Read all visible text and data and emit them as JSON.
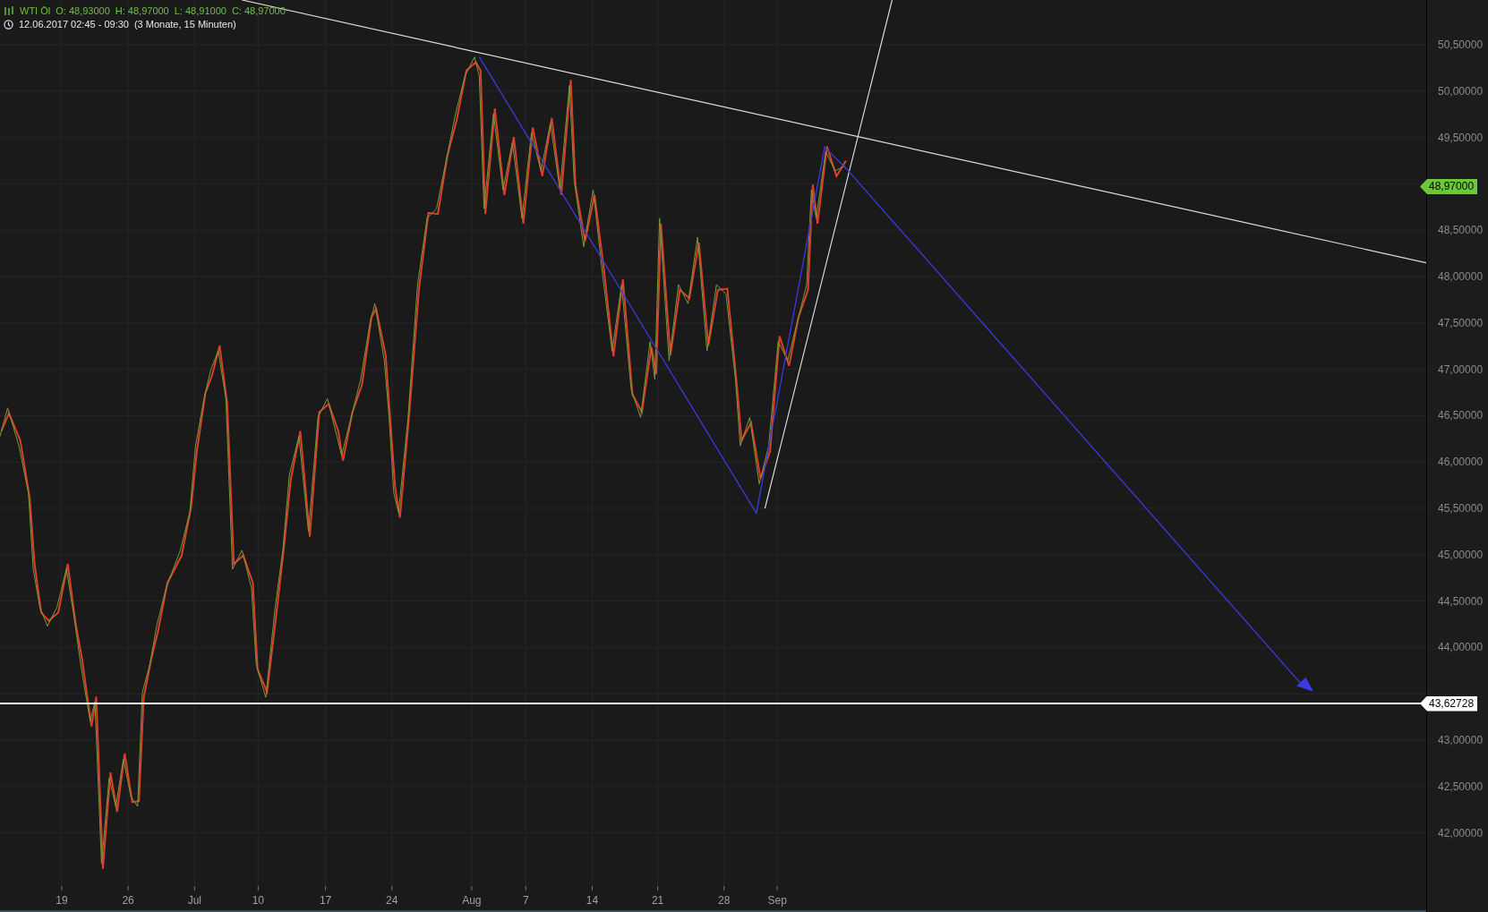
{
  "header": {
    "instrument": "WTI Öl",
    "ohlc": [
      {
        "label": "O:",
        "value": "48,93000"
      },
      {
        "label": "H:",
        "value": "48,97000"
      },
      {
        "label": "L:",
        "value": "48,91000"
      },
      {
        "label": "C:",
        "value": "48,97000"
      }
    ],
    "range": "12.06.2017 02:45 - 09:30",
    "period": "(3 Monate, 15 Minuten)"
  },
  "price_axis": {
    "labels": [
      "50,50000",
      "50,00000",
      "49,50000",
      "48,50000",
      "48,00000",
      "47,50000",
      "47,00000",
      "46,50000",
      "46,00000",
      "45,50000",
      "45,00000",
      "44,50000",
      "44,00000",
      "43,00000",
      "42,50000",
      "42,00000"
    ]
  },
  "price_tags": [
    {
      "kind": "last",
      "text": "48,97000"
    },
    {
      "kind": "line",
      "text": "43,62728"
    }
  ],
  "time_axis": {
    "labels": [
      "19",
      "26",
      "Jul",
      "10",
      "17",
      "24",
      "Aug",
      "7",
      "14",
      "21",
      "28",
      "Sep"
    ]
  }
}
